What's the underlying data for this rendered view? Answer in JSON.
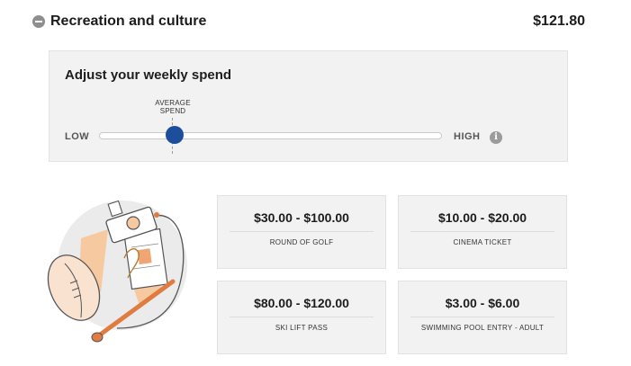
{
  "category": {
    "title": "Recreation and culture",
    "amount": "$121.80"
  },
  "adjust": {
    "title": "Adjust your weekly spend",
    "average_label_line1": "AVERAGE",
    "average_label_line2": "SPEND",
    "low_label": "LOW",
    "high_label": "HIGH",
    "info_glyph": "i",
    "slider_value_fraction": 0.22,
    "accent_color": "#1d4e9c"
  },
  "items": [
    {
      "price": "$30.00 - $100.00",
      "label": "ROUND OF GOLF"
    },
    {
      "price": "$10.00 - $20.00",
      "label": "CINEMA TICKET"
    },
    {
      "price": "$80.00 - $120.00",
      "label": "SKI LIFT PASS"
    },
    {
      "price": "$3.00 - $6.00",
      "label": "SWIMMING POOL ENTRY - ADULT"
    }
  ],
  "icons": [
    "collapse-icon",
    "info-icon",
    "recreation-illustration"
  ]
}
